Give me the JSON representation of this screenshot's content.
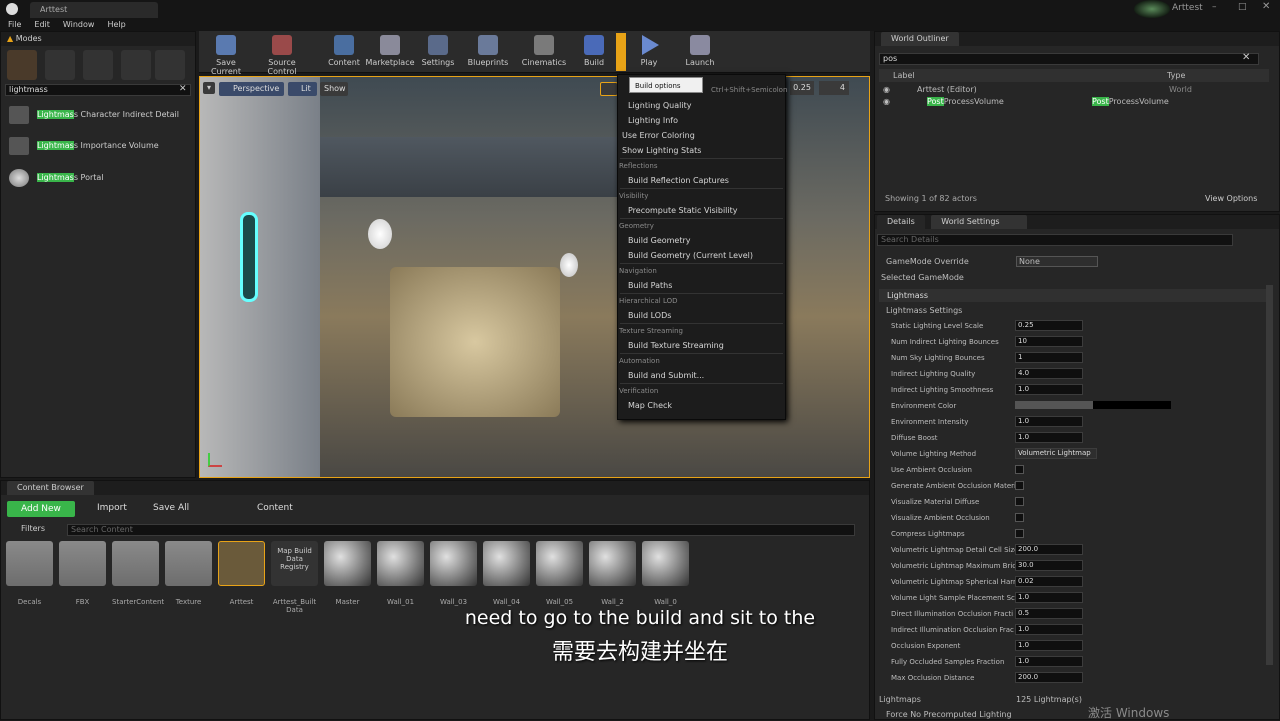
{
  "window": {
    "tab_title": "Arttest",
    "project": "Arttest"
  },
  "menubar": [
    "File",
    "Edit",
    "Window",
    "Help"
  ],
  "modes": {
    "title": "Modes",
    "search": "lightmass",
    "results": [
      {
        "hl": "Lightmas",
        "rest": "s Character Indirect Detail"
      },
      {
        "hl": "Lightmas",
        "rest": "s Importance Volume"
      },
      {
        "hl": "Lightmas",
        "rest": "s Portal"
      }
    ]
  },
  "toolbar": [
    {
      "label": "Save Current"
    },
    {
      "label": "Source Control"
    },
    {
      "label": "Content"
    },
    {
      "label": "Marketplace"
    },
    {
      "label": "Settings"
    },
    {
      "label": "Blueprints"
    },
    {
      "label": "Cinematics"
    },
    {
      "label": "Build"
    },
    {
      "label": "Play"
    },
    {
      "label": "Launch"
    }
  ],
  "viewport": {
    "perspective": "Perspective",
    "lit": "Lit",
    "show": "Show",
    "value1": "0.25",
    "value2": "4"
  },
  "tooltip": {
    "text": "Build options menu",
    "shortcut": "Ctrl+Shift+Semicolon"
  },
  "build_menu": [
    {
      "type": "item",
      "label": "Lighting Quality",
      "arrow": true
    },
    {
      "type": "item",
      "label": "Lighting Info",
      "arrow": true
    },
    {
      "type": "check",
      "label": "Use Error Coloring"
    },
    {
      "type": "check",
      "label": "Show Lighting Stats"
    },
    {
      "type": "sec",
      "label": "Reflections"
    },
    {
      "type": "item",
      "label": "Build Reflection Captures"
    },
    {
      "type": "sec",
      "label": "Visibility"
    },
    {
      "type": "item",
      "label": "Precompute Static Visibility"
    },
    {
      "type": "sec",
      "label": "Geometry"
    },
    {
      "type": "item",
      "label": "Build Geometry"
    },
    {
      "type": "item",
      "label": "Build Geometry (Current Level)"
    },
    {
      "type": "sec",
      "label": "Navigation"
    },
    {
      "type": "item",
      "label": "Build Paths"
    },
    {
      "type": "sec",
      "label": "Hierarchical LOD"
    },
    {
      "type": "item",
      "label": "Build LODs"
    },
    {
      "type": "sec",
      "label": "Texture Streaming"
    },
    {
      "type": "item",
      "label": "Build Texture Streaming"
    },
    {
      "type": "sec",
      "label": "Automation"
    },
    {
      "type": "item",
      "label": "Build and Submit..."
    },
    {
      "type": "sec",
      "label": "Verification"
    },
    {
      "type": "item",
      "label": "Map Check"
    }
  ],
  "outliner": {
    "title": "World Outliner",
    "search": "pos",
    "col_label": "Label",
    "col_type": "Type",
    "rows": [
      {
        "label": "Arttest (Editor)",
        "type": "World"
      },
      {
        "label_hl": "Post",
        "label_rest": "ProcessVolume",
        "type_hl": "Post",
        "type_rest": "ProcessVolume"
      }
    ],
    "status": "Showing 1 of 82 actors",
    "view_options": "View Options"
  },
  "details": {
    "tab1": "Details",
    "tab2": "World Settings",
    "search_placeholder": "Search Details",
    "gamemode_label": "GameMode Override",
    "gamemode_value": "None",
    "selected_gamemode": "Selected GameMode",
    "section": "Lightmass",
    "subsection": "Lightmass Settings",
    "props": [
      {
        "label": "Static Lighting Level Scale",
        "value": "0.25"
      },
      {
        "label": "Num Indirect Lighting Bounces",
        "value": "10"
      },
      {
        "label": "Num Sky Lighting Bounces",
        "value": "1"
      },
      {
        "label": "Indirect Lighting Quality",
        "value": "4.0"
      },
      {
        "label": "Indirect Lighting Smoothness",
        "value": "1.0"
      },
      {
        "label": "Environment Color",
        "value": ""
      },
      {
        "label": "Environment Intensity",
        "value": "1.0"
      },
      {
        "label": "Diffuse Boost",
        "value": "1.0"
      },
      {
        "label": "Volume Lighting Method",
        "value": "Volumetric Lightmap"
      },
      {
        "label": "Use Ambient Occlusion",
        "value": ""
      },
      {
        "label": "Generate Ambient Occlusion Materi",
        "value": ""
      },
      {
        "label": "Visualize Material Diffuse",
        "value": ""
      },
      {
        "label": "Visualize Ambient Occlusion",
        "value": ""
      },
      {
        "label": "Compress Lightmaps",
        "value": ""
      },
      {
        "label": "Volumetric Lightmap Detail Cell Size",
        "value": "200.0"
      },
      {
        "label": "Volumetric Lightmap Maximum Bric",
        "value": "30.0"
      },
      {
        "label": "Volumetric Lightmap Spherical Harr",
        "value": "0.02"
      },
      {
        "label": "Volume Light Sample Placement Sc",
        "value": "1.0"
      },
      {
        "label": "Direct Illumination Occlusion Fracti",
        "value": "0.5"
      },
      {
        "label": "Indirect Illumination Occlusion Frac",
        "value": "1.0"
      },
      {
        "label": "Occlusion Exponent",
        "value": "1.0"
      },
      {
        "label": "Fully Occluded Samples Fraction",
        "value": "1.0"
      },
      {
        "label": "Max Occlusion Distance",
        "value": "200.0"
      }
    ],
    "lightmaps_label": "Lightmaps",
    "lightmaps_value": "125 Lightmap(s)",
    "force_label": "Force No Precomputed Lighting"
  },
  "content_browser": {
    "title": "Content Browser",
    "add_new": "Add New",
    "import": "Import",
    "save_all": "Save All",
    "path": "Content",
    "filters": "Filters",
    "search_placeholder": "Search Content",
    "assets": [
      {
        "name": "Decals",
        "kind": "folder"
      },
      {
        "name": "FBX",
        "kind": "folder"
      },
      {
        "name": "StarterContent",
        "kind": "folder"
      },
      {
        "name": "Texture",
        "kind": "folder"
      },
      {
        "name": "Arttest",
        "kind": "map"
      },
      {
        "name": "Arttest_Built Data",
        "kind": "data",
        "thumb": "Map Build Data Registry"
      },
      {
        "name": "Master",
        "kind": "mat"
      },
      {
        "name": "Wall_01",
        "kind": "mat"
      },
      {
        "name": "Wall_03",
        "kind": "mat"
      },
      {
        "name": "Wall_04",
        "kind": "mat"
      },
      {
        "name": "Wall_05",
        "kind": "mat"
      },
      {
        "name": "Wall_2",
        "kind": "mat"
      },
      {
        "name": "Wall_0",
        "kind": "mat"
      }
    ]
  },
  "subtitle": {
    "en": "need to go to the build and sit to the",
    "zh": "需要去构建并坐在"
  },
  "watermark": "激活 Windows",
  "colors": {
    "accent_green": "#39b54a",
    "highlight": "#e8a317"
  }
}
